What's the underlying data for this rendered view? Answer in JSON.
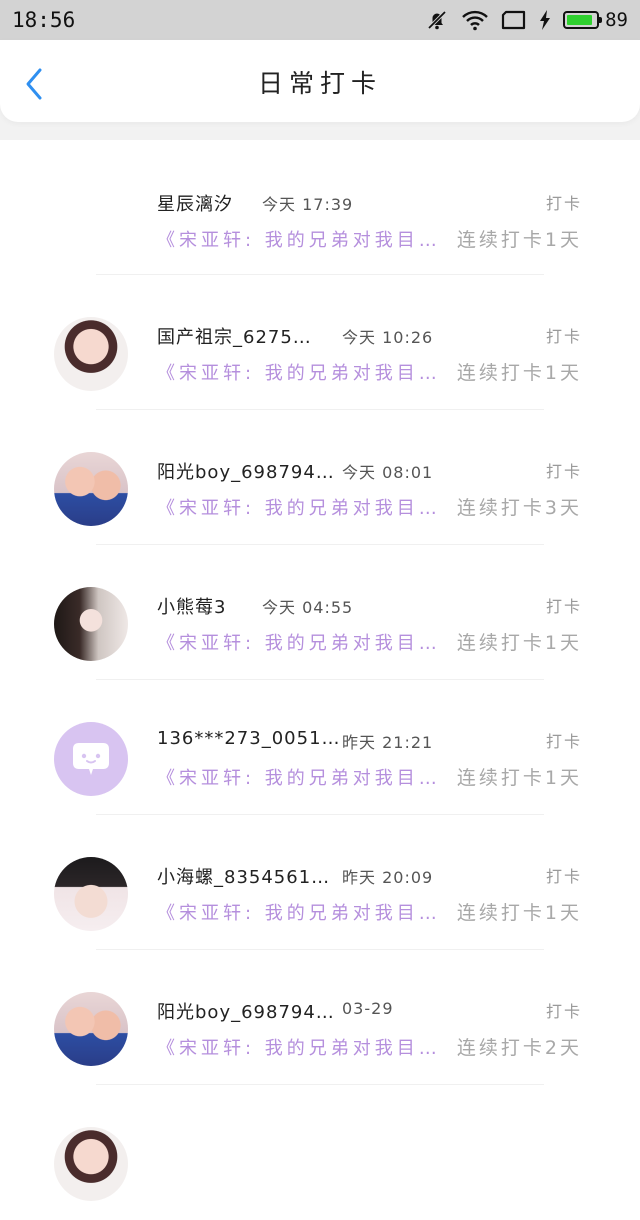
{
  "status_bar": {
    "time": "18:56",
    "battery": "89",
    "battery_color": "#2fd12f",
    "icons": [
      "mute-bell-icon",
      "wifi-icon",
      "screen-rotate-icon",
      "charging-bolt-icon",
      "battery-icon"
    ]
  },
  "header": {
    "title": "日常打卡",
    "back_icon": "chevron-left-icon",
    "accent_color": "#2f8ff0"
  },
  "feed": [
    {
      "name": "星辰漓汐",
      "time": "今天  17:39",
      "action": "打卡",
      "snippet": "《宋亚轩: 我的兄弟对我目…",
      "streak": "连续打卡1天",
      "avatar": "none"
    },
    {
      "name": "国产祖宗_6275…",
      "time": "今天  10:26",
      "action": "打卡",
      "snippet": "《宋亚轩: 我的兄弟对我目…",
      "streak": "连续打卡1天",
      "avatar": "girl-photo"
    },
    {
      "name": "阳光boy_698794…",
      "time": "今天  08:01",
      "action": "打卡",
      "snippet": "《宋亚轩: 我的兄弟对我目…",
      "streak": "连续打卡3天",
      "avatar": "kids-photo"
    },
    {
      "name": "小熊莓3",
      "time": "今天  04:55",
      "action": "打卡",
      "snippet": "《宋亚轩: 我的兄弟对我目…",
      "streak": "连续打卡1天",
      "avatar": "girl-photo"
    },
    {
      "name": "136***273_0051…",
      "time": "昨天  21:21",
      "action": "打卡",
      "snippet": "《宋亚轩: 我的兄弟对我目…",
      "streak": "连续打卡1天",
      "avatar": "default-avatar"
    },
    {
      "name": "小海螺_8354561…",
      "time": "昨天  20:09",
      "action": "打卡",
      "snippet": "《宋亚轩: 我的兄弟对我目…",
      "streak": "连续打卡1天",
      "avatar": "boy-photo"
    },
    {
      "name": "阳光boy_698794…",
      "time": "03-29",
      "action": "打卡",
      "snippet": "《宋亚轩: 我的兄弟对我目…",
      "streak": "连续打卡2天",
      "avatar": "kids-photo"
    }
  ],
  "snippet_color": "#b58fdd"
}
